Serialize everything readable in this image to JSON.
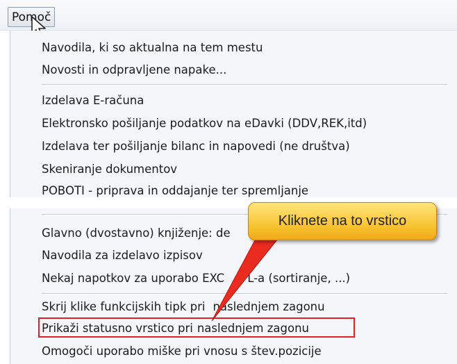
{
  "menubar": {
    "help_label": "Pomoč"
  },
  "menu": {
    "groups": [
      {
        "items": [
          "Navodila, ki so aktualna na tem mestu",
          "Novosti in odpravljene napake..."
        ]
      },
      {
        "items": [
          "Izdelava E-računa",
          "Elektronsko pošiljanje podatkov na eDavki (DDV,REK,itd)",
          "Izdelava ter pošiljanje bilanc in napovedi (ne društva)",
          "Skeniranje dokumentov",
          "POBOTI - priprava in oddajanje ter spremljanje"
        ]
      },
      {
        "items": [
          "Glavno (dvostavno) knjiženje: de",
          "Navodila za izdelavo izpisov",
          "Nekaj napotkov za uporabo EXC",
          "L-a (sortiranje, ...)"
        ]
      },
      {
        "items": [
          "Skrij klike funkcijskih tipk pri",
          "naslednjem zagonu",
          "Prikaži statusno vrstico pri",
          "naslednjem zagonu",
          "Omogoči uporabo miške pri vnosu s štev.pozicije"
        ]
      }
    ]
  },
  "annotation": {
    "callout_text": "Kliknete na to vrstico",
    "color": "#e21f24"
  }
}
